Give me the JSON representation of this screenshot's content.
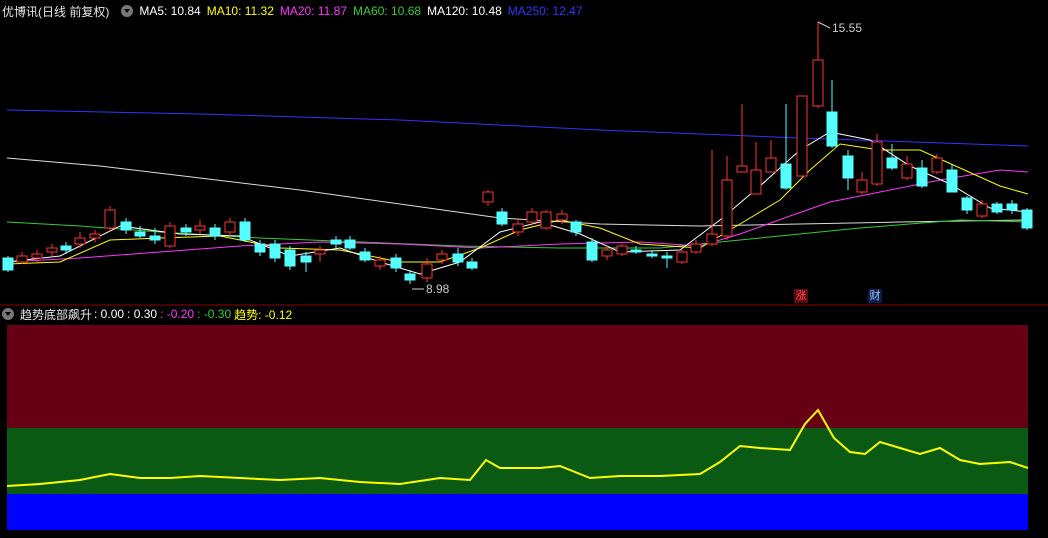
{
  "stock": {
    "name": "优博讯",
    "period": "(日线 前复权)"
  },
  "ma": [
    {
      "label": "MA5: 10.84",
      "color": "#ffffff"
    },
    {
      "label": "MA10: 11.32",
      "color": "#ffff00"
    },
    {
      "label": "MA20: 11.87",
      "color": "#ff33ff"
    },
    {
      "label": "MA60: 10.68",
      "color": "#33cc33"
    },
    {
      "label": "MA120: 10.48",
      "color": "#ffffff"
    },
    {
      "label": "MA250: 12.47",
      "color": "#3333ff"
    }
  ],
  "price_labels": {
    "high": "15.55",
    "low": "8.98"
  },
  "badges": {
    "zhang": "涨",
    "cai": "财"
  },
  "indicator": {
    "name": "趋势底部飙升",
    "values": [
      {
        "label": ": 0.00",
        "color": "#ffffff"
      },
      {
        "label": ": 0.30",
        "color": "#ffffff"
      },
      {
        "label": ": -0.20",
        "color": "#ff33ff"
      },
      {
        "label": ": -0.30",
        "color": "#33cc33"
      },
      {
        "label": "趋势: -0.12",
        "color": "#ffff00"
      }
    ]
  },
  "colors": {
    "up": "#ff3333",
    "down": "#55ffff",
    "band_top": "#660014",
    "band_mid": "#0a5a14",
    "band_bottom": "#0000ff"
  }
}
